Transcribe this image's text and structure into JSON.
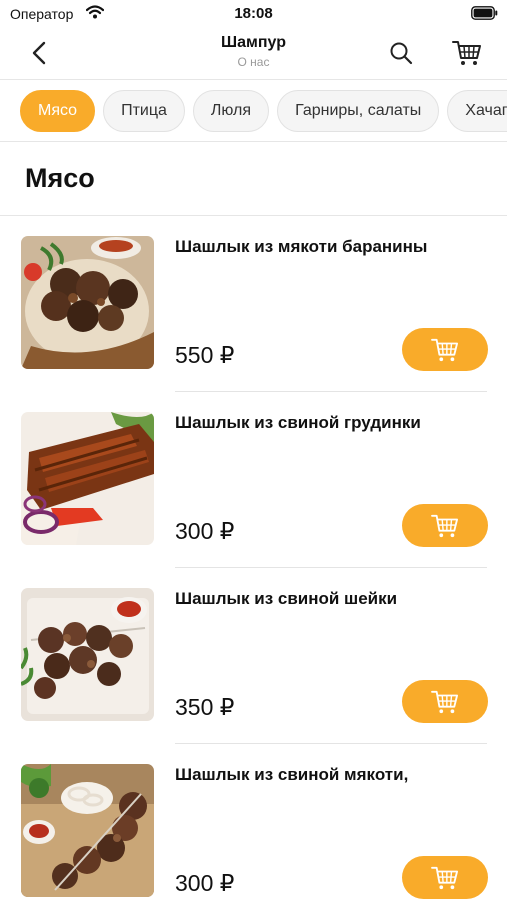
{
  "status_bar": {
    "carrier": "Оператор",
    "time": "18:08"
  },
  "nav": {
    "title": "Шампур",
    "subtitle": "О нас",
    "back_icon": "chevron-left-icon",
    "search_icon": "search-icon",
    "cart_icon": "cart-icon"
  },
  "categories": [
    {
      "label": "Мясо",
      "active": true
    },
    {
      "label": "Птица",
      "active": false
    },
    {
      "label": "Люля",
      "active": false
    },
    {
      "label": "Гарниры, салаты",
      "active": false
    },
    {
      "label": "Хачапури",
      "active": false
    }
  ],
  "section": {
    "title": "Мясо"
  },
  "products": [
    {
      "name": "Шашлык из мякоти баранины",
      "price": "550 ₽"
    },
    {
      "name": "Шашлык из свиной грудинки",
      "price": "300 ₽"
    },
    {
      "name": "Шашлык из свиной шейки",
      "price": "350 ₽"
    },
    {
      "name": "Шашлык из свиной мякоти,",
      "price": "300 ₽"
    }
  ],
  "colors": {
    "accent": "#f9ab2a",
    "divider": "#e6e6e6",
    "chip_background": "#f5f5f5"
  }
}
